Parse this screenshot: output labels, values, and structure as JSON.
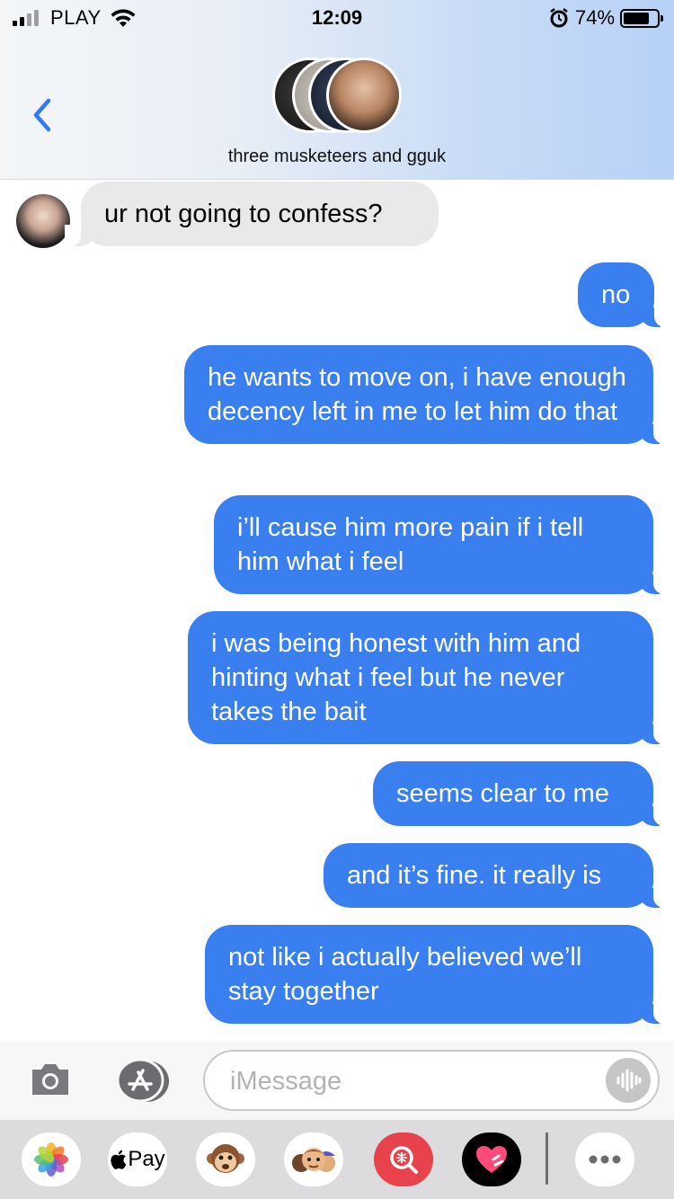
{
  "status_bar": {
    "carrier": "PLAY",
    "time": "12:09",
    "battery_percent": "74%",
    "battery_level": 0.74,
    "icons": [
      "signal-icon",
      "wifi-icon",
      "alarm-icon",
      "battery-icon"
    ]
  },
  "header": {
    "group_name": "three musketeers and gguk",
    "back_icon": "chevron-left-icon"
  },
  "messages": [
    {
      "direction": "incoming",
      "text": "ur not going to confess?"
    },
    {
      "direction": "outgoing",
      "text": "no"
    },
    {
      "direction": "outgoing",
      "text": "he wants to move on, i have enough decency left in me to let him do that"
    },
    {
      "direction": "outgoing",
      "text": "i’ll cause him more pain if i tell him what i feel"
    },
    {
      "direction": "outgoing",
      "text": "i was being honest with him and hinting what i feel but he never takes the bait"
    },
    {
      "direction": "outgoing",
      "text": "seems clear to me"
    },
    {
      "direction": "outgoing",
      "text": "and it’s fine. it really is"
    },
    {
      "direction": "outgoing",
      "text": "not like i actually believed we’ll stay together"
    }
  ],
  "composer": {
    "placeholder": "iMessage",
    "value": ""
  },
  "app_drawer": {
    "items": [
      "photos-icon",
      "apple-pay-icon",
      "monkey-animoji-icon",
      "memoji-icon",
      "image-search-icon",
      "digital-touch-icon",
      "more-icon"
    ],
    "apple_pay_label": "Pay"
  },
  "colors": {
    "outgoing_bubble": "#3a7ff0",
    "incoming_bubble": "#e9e9eb",
    "accent": "#3478f6"
  }
}
